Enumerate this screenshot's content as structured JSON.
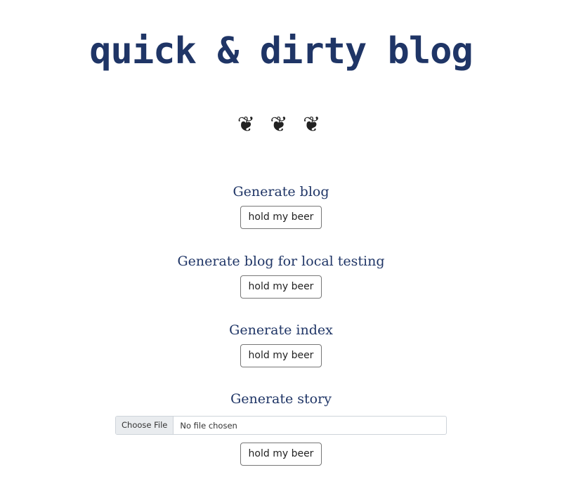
{
  "header": {
    "title": "quick & dirty blog",
    "ornament": "❦ ❦ ❦"
  },
  "sections": [
    {
      "heading": "Generate blog",
      "button_label": "hold my beer"
    },
    {
      "heading": "Generate blog for local testing",
      "button_label": "hold my beer"
    },
    {
      "heading": "Generate index",
      "button_label": "hold my beer"
    },
    {
      "heading": "Generate story",
      "file_input": {
        "choose_label": "Choose File",
        "status": "No file chosen"
      },
      "button_label": "hold my beer"
    }
  ],
  "colors": {
    "heading": "#1f3566",
    "button_border": "#777777",
    "file_button_bg": "#e9ecef"
  }
}
